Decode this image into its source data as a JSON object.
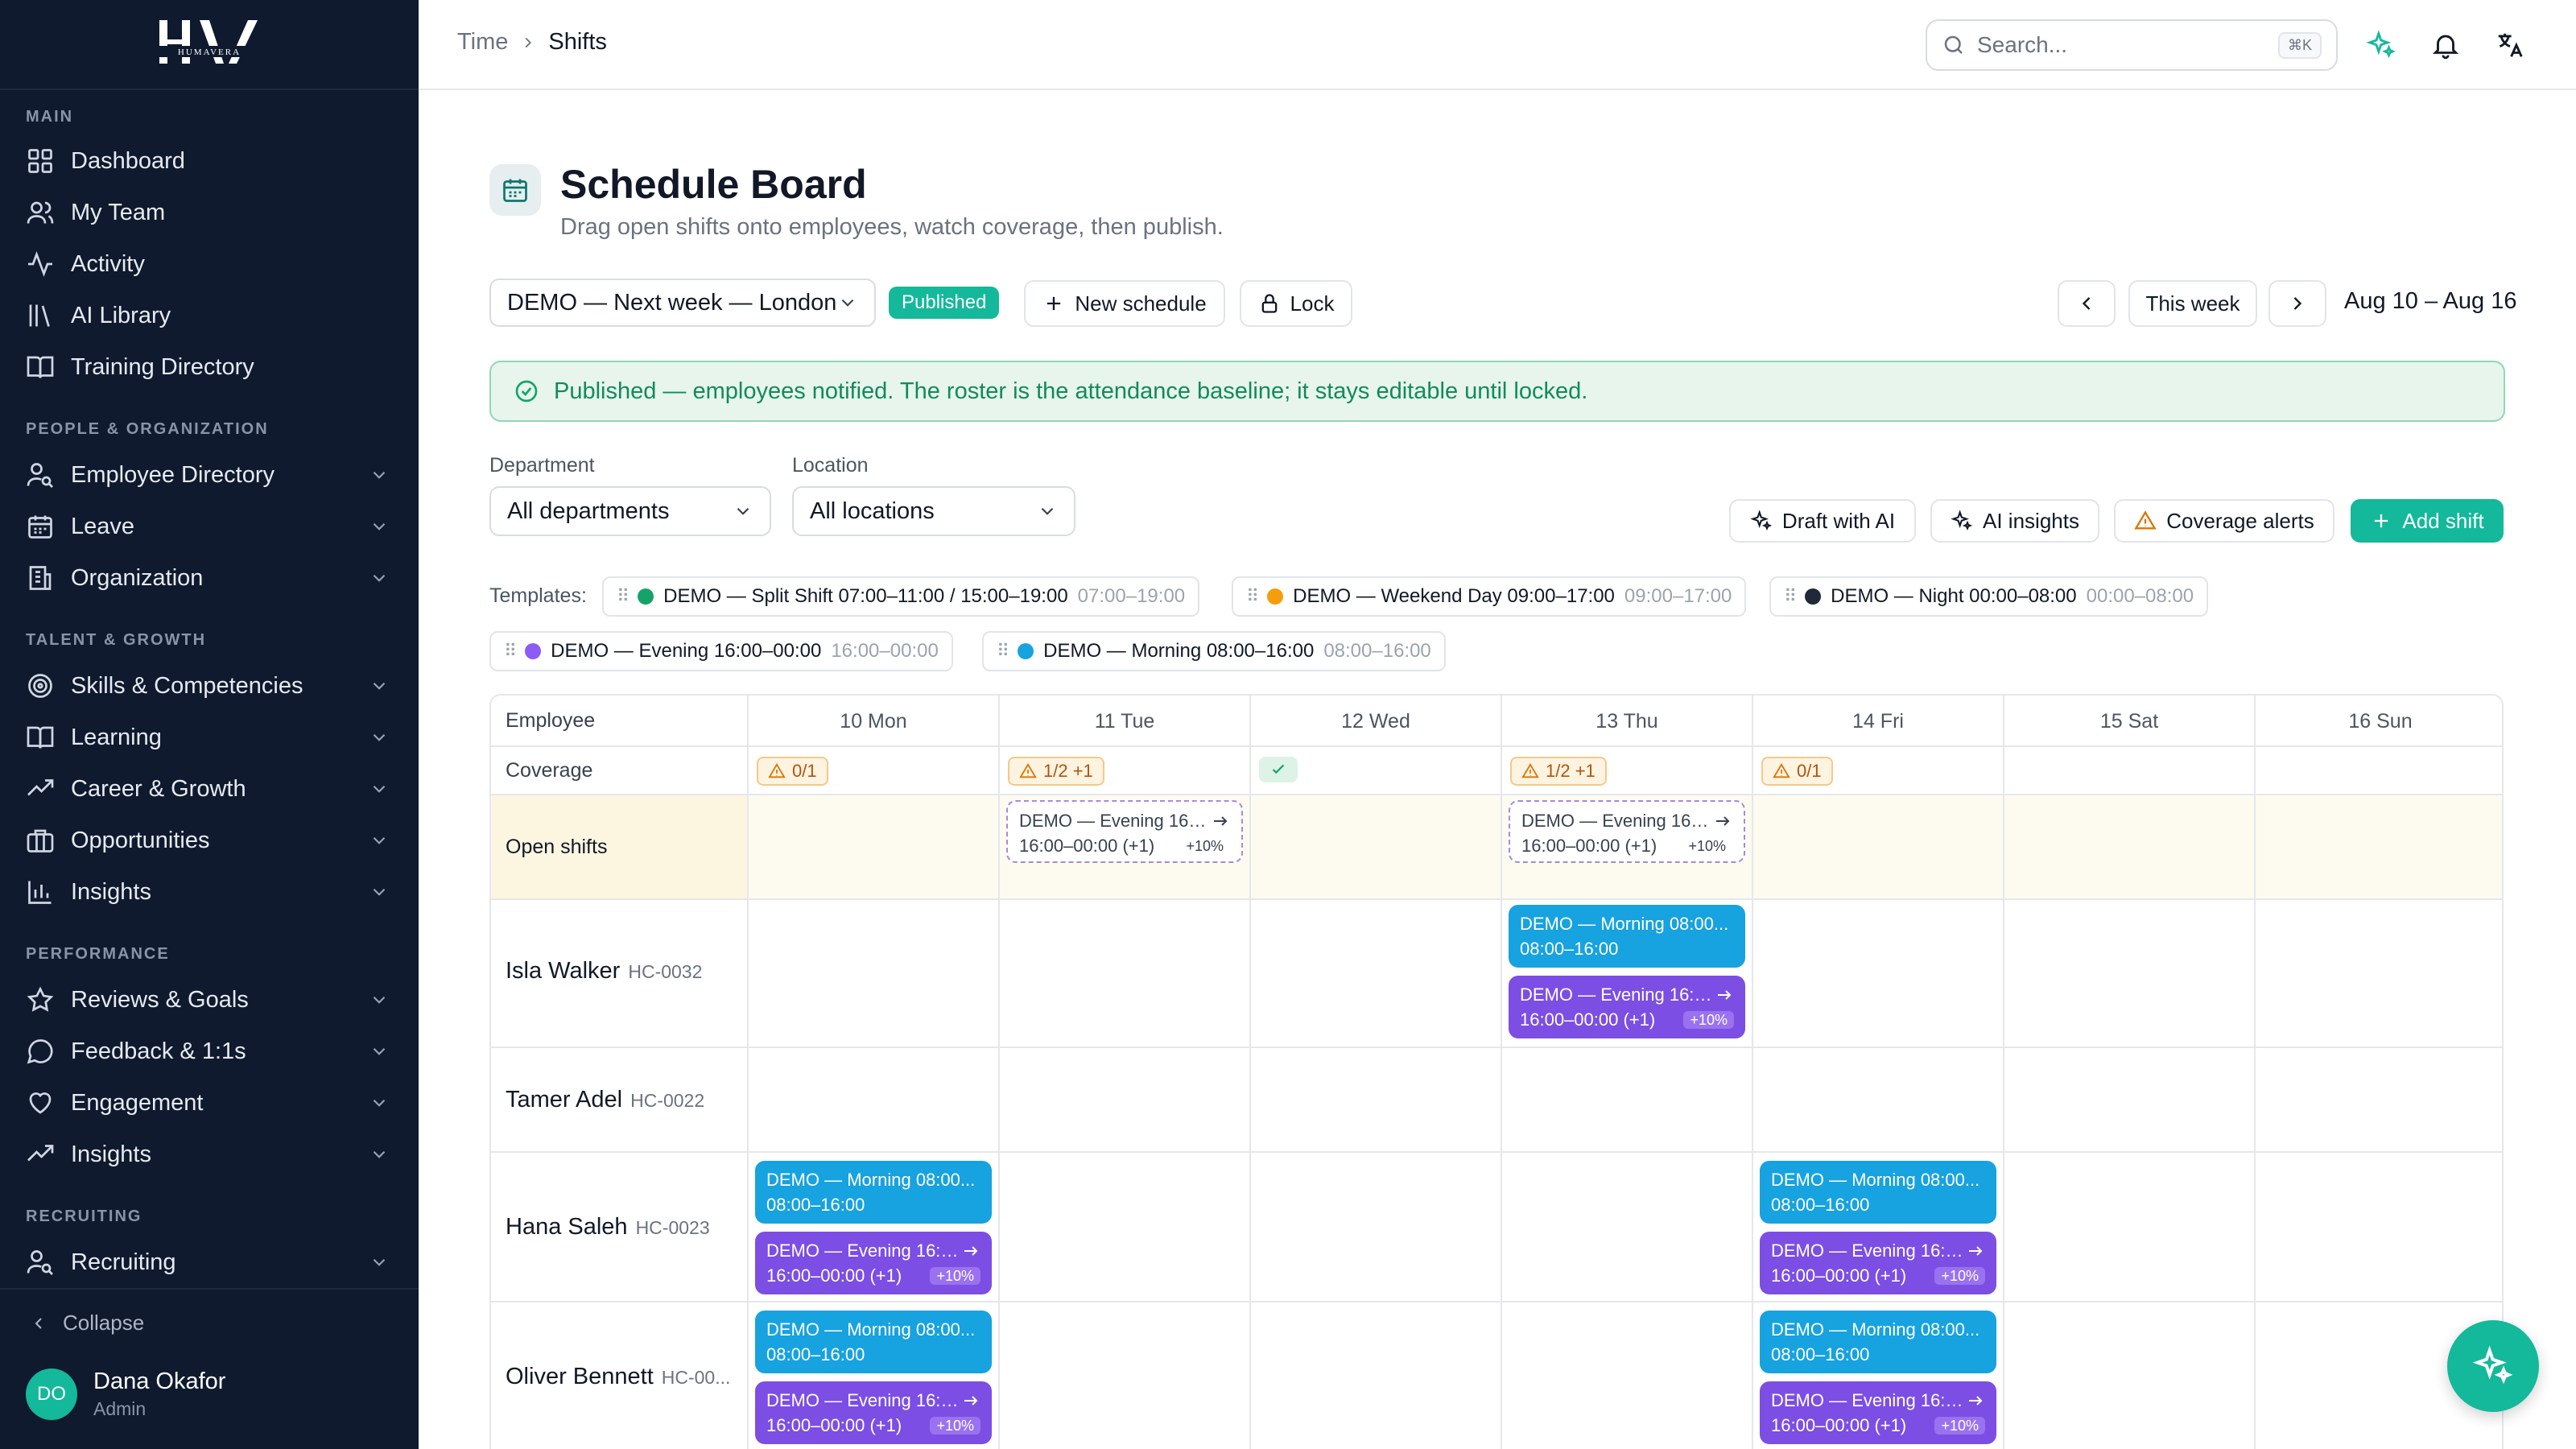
{
  "brand": {
    "logo_text": "HUMAVERA"
  },
  "sidebar": {
    "sections": {
      "main": "MAIN",
      "people": "PEOPLE & ORGANIZATION",
      "talent": "TALENT & GROWTH",
      "performance": "PERFORMANCE",
      "recruiting": "RECRUITING"
    },
    "items": [
      {
        "label": "Dashboard",
        "icon": "grid-icon"
      },
      {
        "label": "My Team",
        "icon": "users-icon"
      },
      {
        "label": "Activity",
        "icon": "activity-icon"
      },
      {
        "label": "AI Library",
        "icon": "library-icon"
      },
      {
        "label": "Training Directory",
        "icon": "book-icon"
      },
      {
        "label": "Employee Directory",
        "icon": "user-search-icon"
      },
      {
        "label": "Leave",
        "icon": "calendar-icon"
      },
      {
        "label": "Organization",
        "icon": "building-icon"
      },
      {
        "label": "Skills & Competencies",
        "icon": "target-icon"
      },
      {
        "label": "Learning",
        "icon": "book-icon"
      },
      {
        "label": "Career & Growth",
        "icon": "trending-icon"
      },
      {
        "label": "Opportunities",
        "icon": "briefcase-icon"
      },
      {
        "label": "Insights",
        "icon": "bar-chart-icon"
      },
      {
        "label": "Reviews & Goals",
        "icon": "star-icon"
      },
      {
        "label": "Feedback & 1:1s",
        "icon": "chat-icon"
      },
      {
        "label": "Engagement",
        "icon": "heart-icon"
      },
      {
        "label": "Insights",
        "icon": "trending-icon"
      },
      {
        "label": "Recruiting",
        "icon": "user-search-icon"
      }
    ],
    "collapse_label": "Collapse",
    "user": {
      "initials": "DO",
      "name": "Dana Okafor",
      "role": "Admin"
    }
  },
  "topbar": {
    "breadcrumb": [
      "Time",
      "Shifts"
    ],
    "search_placeholder": "Search...",
    "search_shortcut": "⌘K"
  },
  "page": {
    "title": "Schedule Board",
    "subtitle": "Drag open shifts onto employees, watch coverage, then publish."
  },
  "toolbar": {
    "schedule_select": "DEMO — Next week — London C",
    "status_badge": "Published",
    "new_schedule": "New schedule",
    "lock": "Lock",
    "this_week": "This week",
    "week_range": "Aug 10 – Aug 16"
  },
  "banner": "Published — employees notified. The roster is the attendance baseline; it stays editable until locked.",
  "filters": {
    "department_label": "Department",
    "department_value": "All departments",
    "location_label": "Location",
    "location_value": "All locations"
  },
  "actions": {
    "draft_ai": "Draft with AI",
    "ai_insights": "AI insights",
    "coverage_alerts": "Coverage alerts",
    "add_shift": "Add shift"
  },
  "templates": {
    "label": "Templates:",
    "items": [
      {
        "name": "DEMO — Split Shift 07:00–11:00 / 15:00–19:00",
        "time": "07:00–19:00",
        "color": "#16a36a"
      },
      {
        "name": "DEMO — Weekend Day 09:00–17:00",
        "time": "09:00–17:00",
        "color": "#f59e0b"
      },
      {
        "name": "DEMO — Night 00:00–08:00",
        "time": "00:00–08:00",
        "color": "#1f2937"
      },
      {
        "name": "DEMO — Evening 16:00–00:00",
        "time": "16:00–00:00",
        "color": "#8b5cf6"
      },
      {
        "name": "DEMO — Morning 08:00–16:00",
        "time": "08:00–16:00",
        "color": "#17a2e0"
      }
    ]
  },
  "grid": {
    "employee_header": "Employee",
    "coverage_label": "Coverage",
    "open_shifts_label": "Open shifts",
    "days": [
      "10 Mon",
      "11 Tue",
      "12 Wed",
      "13 Thu",
      "14 Fri",
      "15 Sat",
      "16 Sun"
    ],
    "coverage": [
      "0/1",
      "1/2 +1",
      "",
      "1/2 +1",
      "0/1",
      "",
      ""
    ],
    "open_shift": {
      "title": "DEMO — Evening 16:0...",
      "time": "16:00–00:00 (+1)",
      "pct": "+10%"
    },
    "morning_shift": {
      "title": "DEMO — Morning 08:00...",
      "time": "08:00–16:00"
    },
    "evening_shift": {
      "title": "DEMO — Evening 16:0...",
      "time": "16:00–00:00 (+1)",
      "pct": "+10%"
    },
    "employees": [
      {
        "name": "Isla Walker",
        "code": "HC-0032"
      },
      {
        "name": "Tamer Adel",
        "code": "HC-0022"
      },
      {
        "name": "Hana Saleh",
        "code": "HC-0023"
      },
      {
        "name": "Oliver Bennett",
        "code": "HC-00..."
      }
    ]
  }
}
